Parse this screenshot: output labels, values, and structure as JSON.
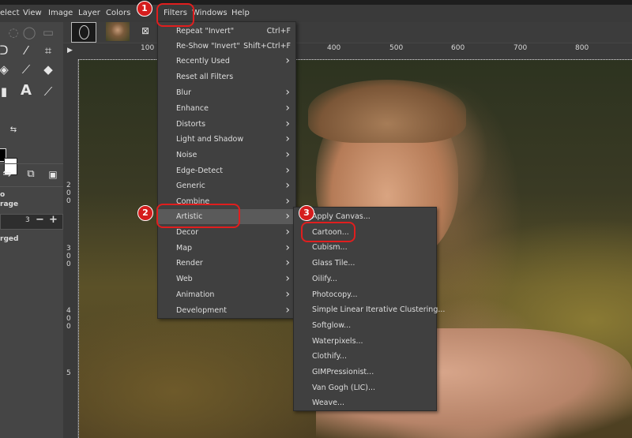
{
  "menubar": {
    "items": [
      "elect",
      "View",
      "Image",
      "Layer",
      "Colors",
      "Filters",
      "Windows",
      "Help"
    ]
  },
  "image_tabs": {
    "close_glyph": "⊠"
  },
  "ruler": {
    "top_labels": [
      "100",
      "400",
      "500",
      "600",
      "700",
      "800"
    ],
    "left_labels": [
      "2",
      "0",
      "0",
      "3",
      "0",
      "0",
      "4",
      "0",
      "0",
      "5"
    ]
  },
  "tool_options": {
    "line1": "o",
    "line2": "rage",
    "spin_value": "3",
    "minus": "−",
    "plus": "+",
    "line3": "rged"
  },
  "filters_menu": {
    "items": [
      {
        "label": "Repeat \"Invert\"",
        "shortcut": "Ctrl+F",
        "submenu": false
      },
      {
        "label": "Re-Show \"Invert\"",
        "shortcut": "Shift+Ctrl+F",
        "submenu": false
      },
      {
        "label": "Recently Used",
        "shortcut": "",
        "submenu": true
      },
      {
        "label": "Reset all Filters",
        "shortcut": "",
        "submenu": false
      },
      {
        "label": "Blur",
        "shortcut": "",
        "submenu": true
      },
      {
        "label": "Enhance",
        "shortcut": "",
        "submenu": true
      },
      {
        "label": "Distorts",
        "shortcut": "",
        "submenu": true
      },
      {
        "label": "Light and Shadow",
        "shortcut": "",
        "submenu": true
      },
      {
        "label": "Noise",
        "shortcut": "",
        "submenu": true
      },
      {
        "label": "Edge-Detect",
        "shortcut": "",
        "submenu": true
      },
      {
        "label": "Generic",
        "shortcut": "",
        "submenu": true
      },
      {
        "label": "Combine",
        "shortcut": "",
        "submenu": true
      },
      {
        "label": "Artistic",
        "shortcut": "",
        "submenu": true
      },
      {
        "label": "Decor",
        "shortcut": "",
        "submenu": true
      },
      {
        "label": "Map",
        "shortcut": "",
        "submenu": true
      },
      {
        "label": "Render",
        "shortcut": "",
        "submenu": true
      },
      {
        "label": "Web",
        "shortcut": "",
        "submenu": true
      },
      {
        "label": "Animation",
        "shortcut": "",
        "submenu": true
      },
      {
        "label": "Development",
        "shortcut": "",
        "submenu": true
      }
    ]
  },
  "artistic_submenu": {
    "items": [
      "Apply Canvas...",
      "Cartoon...",
      "Cubism...",
      "Glass Tile...",
      "Oilify...",
      "Photocopy...",
      "Simple Linear Iterative Clustering...",
      "Softglow...",
      "Waterpixels...",
      "Clothify...",
      "GIMPressionist...",
      "Van Gogh (LIC)...",
      "Weave..."
    ]
  },
  "annotations": {
    "badges": [
      "1",
      "2",
      "3"
    ],
    "color": "#e01e1e"
  },
  "colors": {
    "menu_bg": "#404040",
    "highlight": "#5a5a5a",
    "toolbox_bg": "#454545"
  }
}
